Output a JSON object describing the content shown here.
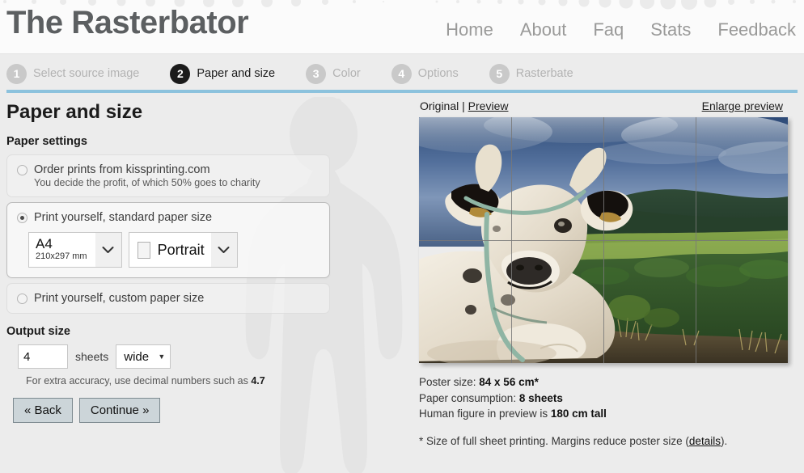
{
  "site": {
    "logo": "The Rasterbator",
    "nav": [
      {
        "label": "Home"
      },
      {
        "label": "About"
      },
      {
        "label": "Faq"
      },
      {
        "label": "Stats"
      },
      {
        "label": "Feedback"
      }
    ]
  },
  "steps": [
    {
      "num": "1",
      "label": "Select source image",
      "active": false
    },
    {
      "num": "2",
      "label": "Paper and size",
      "active": true
    },
    {
      "num": "3",
      "label": "Color",
      "active": false
    },
    {
      "num": "4",
      "label": "Options",
      "active": false
    },
    {
      "num": "5",
      "label": "Rasterbate",
      "active": false
    }
  ],
  "page": {
    "title": "Paper and size",
    "paper_settings_title": "Paper settings",
    "output_size_title": "Output size"
  },
  "paper_options": {
    "order_prints": {
      "label": "Order prints from kissprinting.com",
      "sub": "You decide the profit, of which 50% goes to charity",
      "selected": false
    },
    "standard": {
      "label": "Print yourself, standard paper size",
      "selected": true,
      "size_select": {
        "value": "A4",
        "dimensions": "210x297 mm"
      },
      "orientation_select": {
        "value": "Portrait"
      }
    },
    "custom": {
      "label": "Print yourself, custom paper size",
      "selected": false
    }
  },
  "output": {
    "sheets_value": "4",
    "sheets_label": "sheets",
    "direction_value": "wide",
    "hint_prefix": "For extra accuracy, use decimal numbers such as ",
    "hint_number": "4.7"
  },
  "buttons": {
    "back": "« Back",
    "continue": "Continue »"
  },
  "preview": {
    "original_label": "Original",
    "separator": "|",
    "preview_label": "Preview",
    "enlarge_label": "Enlarge preview",
    "grid_cols": "4",
    "grid_rows": "2"
  },
  "summary": {
    "poster_size_label": "Poster size: ",
    "poster_size_value": "84 x 56 cm*",
    "paper_consumption_label": "Paper consumption: ",
    "paper_consumption_value": "8 sheets",
    "human_figure_text": "Human figure in preview is ",
    "human_figure_value": "180 cm tall",
    "footnote_pre": "* Size of full sheet printing. Margins reduce poster size (",
    "footnote_link": "details",
    "footnote_post": ")."
  },
  "colors": {
    "accent_rule": "#8cc2dd",
    "page_bg": "#ececec",
    "header_bg": "#fbfbfb",
    "nav_text": "#9a9a99",
    "logo_text": "#5c5f61",
    "step_inactive": "#c9c9c9",
    "step_active": "#1b1b1b",
    "button_bg": "#ccd5d9"
  }
}
